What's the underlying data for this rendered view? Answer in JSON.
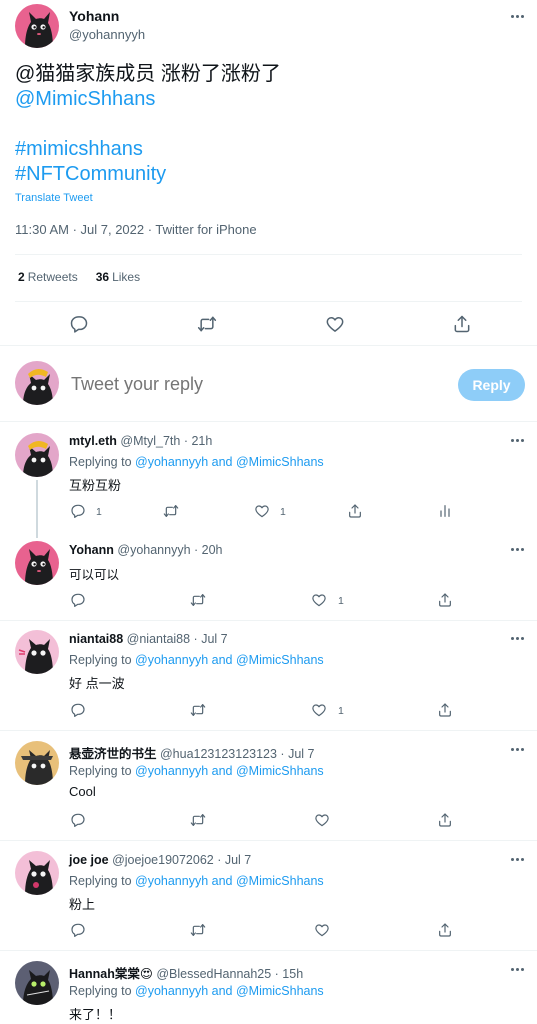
{
  "main_tweet": {
    "author_name": "Yohann",
    "author_handle": "@yohannyyh",
    "text_lines": [
      "@猫猫家族成员 涨粉了涨粉了",
      "@MimicShhans",
      "",
      "#mimicshhans",
      "#NFTCommunity"
    ],
    "translate_label": "Translate Tweet",
    "timestamp": "11:30 AM · Jul 7, 2022 · Twitter for iPhone",
    "retweets_count": "2",
    "retweets_label": "Retweets",
    "likes_count": "36",
    "likes_label": "Likes"
  },
  "reply_box": {
    "placeholder": "Tweet your reply",
    "button_label": "Reply"
  },
  "replies": [
    {
      "name": "mtyl.eth",
      "meta": " @Mtyl_7th · 21h",
      "replying_prefix": "Replying to ",
      "replying_targets": "@yohannyyh and @MimicShhans",
      "text": "互粉互粉",
      "reply_count": "1",
      "retweet_count": "",
      "like_count": "1"
    },
    {
      "name": "Yohann",
      "meta": " @yohannyyh · 20h",
      "text": "可以可以",
      "reply_count": "",
      "retweet_count": "",
      "like_count": "1"
    },
    {
      "name": "niantai88",
      "meta": " @niantai88 · Jul 7",
      "replying_prefix": "Replying to ",
      "replying_targets": "@yohannyyh and @MimicShhans",
      "text": "好 点一波",
      "reply_count": "",
      "retweet_count": "",
      "like_count": "1"
    },
    {
      "name": "悬壶济世的书生",
      "meta": " @hua123123123123 · Jul 7",
      "replying_prefix": "Replying to ",
      "replying_targets": "@yohannyyh and @MimicShhans",
      "text": "Cool"
    },
    {
      "name": "joe joe",
      "meta": " @joejoe19072062 · Jul 7",
      "replying_prefix": "Replying to ",
      "replying_targets": "@yohannyyh and @MimicShhans",
      "text": "粉上"
    },
    {
      "name": "Hannah棠棠😍",
      "meta": " @BlessedHannah25 · 15h",
      "replying_prefix": "Replying to ",
      "replying_targets": "@yohannyyh and @MimicShhans",
      "text": "来了！！"
    }
  ],
  "icons": {
    "reply": "comment-icon",
    "retweet": "retweet-icon",
    "like": "heart-icon",
    "share": "share-icon",
    "analytics": "analytics-icon",
    "more": "more-icon"
  },
  "colors": {
    "link": "#1d9bf0",
    "secondary_text": "#536471",
    "reply_button_disabled": "#8ecdf8",
    "divider": "#eff3f4"
  }
}
